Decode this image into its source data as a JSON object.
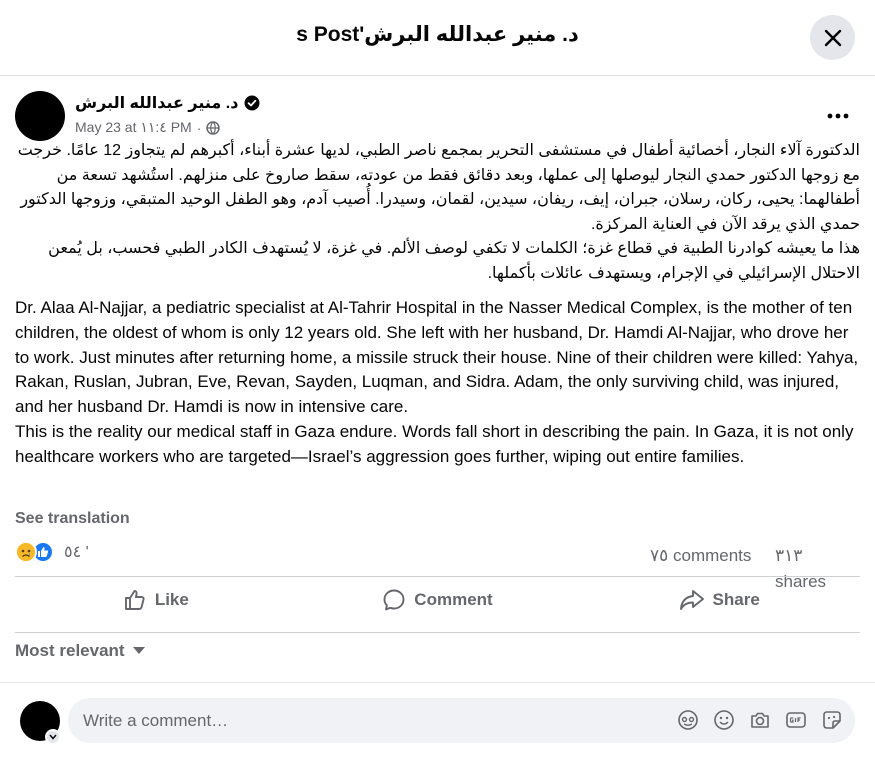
{
  "header": {
    "title": "د. منير عبدالله البرش's Post"
  },
  "post": {
    "author": "د. منير عبدالله البرش",
    "date": "May 23 at ١١:٤ PM",
    "privacy_separator": "·",
    "text_ar": "الدكتورة آلاء النجار، أخصائية أطفال في مستشفى التحرير بمجمع ناصر الطبي، لديها عشرة أبناء، أكبرهم لم يتجاوز 12 عامًا. خرجت مع زوجها الدكتور حمدي النجار ليوصلها إلى عملها، وبعد دقائق فقط من عودته، سقط صاروخ على منزلهم. استُشهد تسعة من أطفالهما: يحيى، ركان، رسلان، جبران، إيف، ريفان، سيدين، لقمان، وسيدرا. أُصيب آدم، وهو الطفل الوحيد المتبقي، وزوجها الدكتور حمدي الذي يرقد الآن في العناية المركزة.\nهذا ما يعيشه كوادرنا الطبية في قطاع غزة؛ الكلمات لا تكفي لوصف الألم. في غزة، لا يُستهدف الكادر الطبي فحسب، بل يُمعن الاحتلال الإسرائيلي في الإجرام، ويستهدف عائلات بأكملها.",
    "text_en": "Dr. Alaa Al-Najjar, a pediatric specialist at Al-Tahrir Hospital in the Nasser Medical Complex, is the mother of ten children, the oldest of whom is only 12 years old. She left with her husband, Dr. Hamdi Al-Najjar, who drove her to work. Just minutes after returning home, a missile struck their house. Nine of their children were killed: Yahya, Rakan, Ruslan, Jubran, Eve, Revan, Sayden, Luqman, and Sidra. Adam, the only surviving child, was injured, and her husband Dr. Hamdi is now in intensive care.\nThis is the reality our medical staff in Gaza endure. Words fall short in describing the pain. In Gaza, it is not only healthcare workers who are targeted—Israel’s aggression goes further, wiping out entire families.",
    "see_translation": "See translation",
    "reactions_count": "٥٤ '",
    "comments_count": "٧٥ comments",
    "shares_count": "٣١٣ shares"
  },
  "actions": {
    "like": "Like",
    "comment": "Comment",
    "share": "Share"
  },
  "comments": {
    "sort_label": "Most relevant"
  },
  "composer": {
    "placeholder": "Write a comment…"
  },
  "colors": {
    "accent": "#1877f2",
    "muted": "#65676b",
    "divider": "#ced0d4",
    "input_bg": "#f0f2f5"
  },
  "icons": [
    "close-icon",
    "verified-icon",
    "globe-icon",
    "more-icon",
    "sad-reaction-icon",
    "like-reaction-icon",
    "like-icon",
    "comment-icon",
    "share-icon",
    "caret-down-icon",
    "avatar-sticker-icon",
    "emoji-icon",
    "camera-icon",
    "gif-icon",
    "sticker-icon"
  ]
}
